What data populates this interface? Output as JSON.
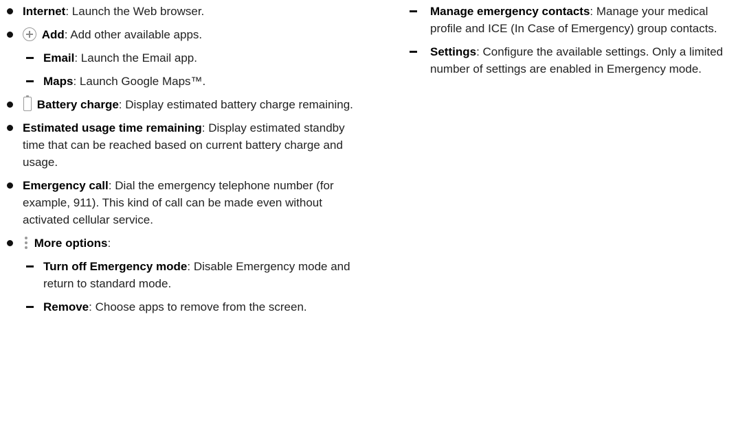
{
  "left_column": [
    {
      "type": "bullet",
      "icon": null,
      "term": "Internet",
      "desc": ": Launch the Web browser."
    },
    {
      "type": "bullet",
      "icon": "add-icon",
      "term": "Add",
      "desc": ": Add other available apps."
    },
    {
      "type": "dash",
      "icon": null,
      "term": "Email",
      "desc": ": Launch the Email app."
    },
    {
      "type": "dash",
      "icon": null,
      "term": "Maps",
      "desc": ": Launch Google Maps™."
    },
    {
      "type": "bullet",
      "icon": "battery-icon",
      "term": "Battery charge",
      "desc": ": Display estimated battery charge remaining."
    },
    {
      "type": "bullet",
      "icon": null,
      "term": "Estimated usage time remaining",
      "desc": ": Display estimated standby time that can be reached based on current battery charge and usage."
    },
    {
      "type": "bullet",
      "icon": null,
      "term": "Emergency call",
      "desc": ": Dial the emergency telephone number (for example, 911). This kind of call can be made even without activated cellular service."
    },
    {
      "type": "bullet",
      "icon": "more-options-icon",
      "term": "More options",
      "desc": ":"
    },
    {
      "type": "dash",
      "icon": null,
      "term": "Turn off Emergency mode",
      "desc": ": Disable Emergency mode and return to standard mode."
    },
    {
      "type": "dash",
      "icon": null,
      "term": "Remove",
      "desc": ": Choose apps to remove from the screen."
    }
  ],
  "right_column": [
    {
      "type": "dash",
      "icon": null,
      "term": "Manage emergency contacts",
      "desc": ": Manage your medical profile and ICE (In Case of Emergency) group contacts."
    },
    {
      "type": "dash",
      "icon": null,
      "term": "Settings",
      "desc": ": Configure the available settings. Only a limited number of settings are enabled in Emergency mode."
    }
  ]
}
